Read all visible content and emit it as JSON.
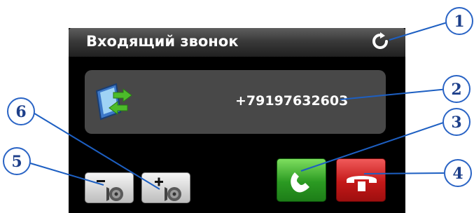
{
  "screen": {
    "title": "Входящий звонок",
    "phone_number": "+79197632603"
  },
  "icons": {
    "refresh": "refresh-icon",
    "caller": "incoming-call-icon",
    "volume_down": "speaker-minus-icon",
    "volume_up": "speaker-plus-icon",
    "answer": "phone-handset-icon",
    "decline": "hang-up-icon"
  },
  "callouts": [
    "1",
    "2",
    "3",
    "4",
    "5",
    "6"
  ],
  "colors": {
    "screen_bg": "#000000",
    "panel_bg": "#484848",
    "answer_green": "#2b9a22",
    "decline_red": "#c41818",
    "callout_blue": "#1d3f8a"
  }
}
